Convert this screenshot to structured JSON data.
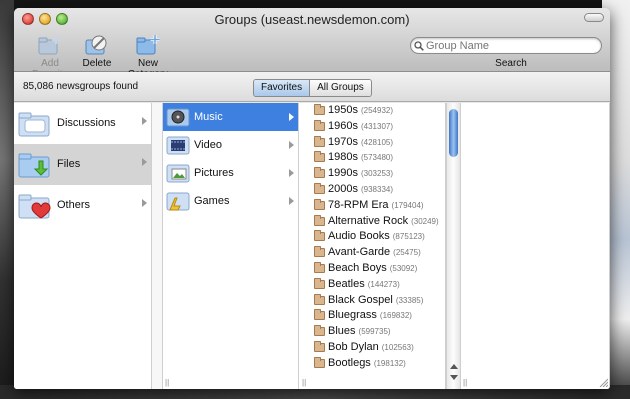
{
  "window": {
    "title": "Groups (useast.newsdemon.com)"
  },
  "toolbar": {
    "add_favorite": "Add Favorite",
    "delete": "Delete",
    "new_category": "New Category"
  },
  "search": {
    "placeholder": "Group Name",
    "label": "Search"
  },
  "status": {
    "count_text": "85,086 newsgroups found"
  },
  "tabs": {
    "favorites": "Favorites",
    "all_groups": "All Groups",
    "selected": "Favorites"
  },
  "categories": [
    {
      "label": "Discussions"
    },
    {
      "label": "Files"
    },
    {
      "label": "Others"
    }
  ],
  "subcategories": [
    {
      "label": "Music"
    },
    {
      "label": "Video"
    },
    {
      "label": "Pictures"
    },
    {
      "label": "Games"
    }
  ],
  "groups": [
    {
      "name": "1950s",
      "count": "(254932)"
    },
    {
      "name": "1960s",
      "count": "(431307)"
    },
    {
      "name": "1970s",
      "count": "(428105)"
    },
    {
      "name": "1980s",
      "count": "(573480)"
    },
    {
      "name": "1990s",
      "count": "(303253)"
    },
    {
      "name": "2000s",
      "count": "(938334)"
    },
    {
      "name": "78-RPM Era",
      "count": "(179404)"
    },
    {
      "name": "Alternative Rock",
      "count": "(30249)"
    },
    {
      "name": "Audio Books",
      "count": "(875123)"
    },
    {
      "name": "Avant-Garde",
      "count": "(25475)"
    },
    {
      "name": "Beach Boys",
      "count": "(53092)"
    },
    {
      "name": "Beatles",
      "count": "(144273)"
    },
    {
      "name": "Black Gospel",
      "count": "(33385)"
    },
    {
      "name": "Bluegrass",
      "count": "(169832)"
    },
    {
      "name": "Blues",
      "count": "(599735)"
    },
    {
      "name": "Bob Dylan",
      "count": "(102563)"
    },
    {
      "name": "Bootlegs",
      "count": "(198132)"
    }
  ],
  "colors": {
    "selection": "#3d80df",
    "category_selected": "#d4d4d4"
  }
}
